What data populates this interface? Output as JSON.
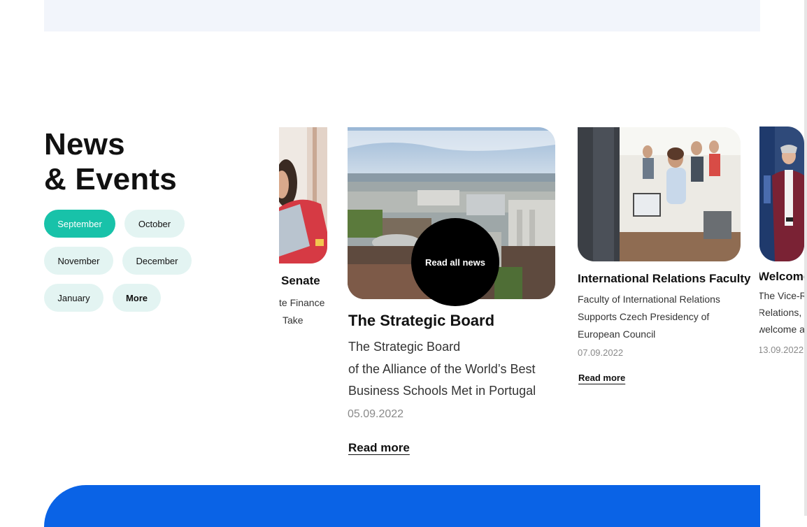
{
  "section": {
    "title_line1": "News",
    "title_line2": "& Events"
  },
  "months": [
    {
      "label": "September",
      "active": true
    },
    {
      "label": "October",
      "active": false
    },
    {
      "label": "November",
      "active": false
    },
    {
      "label": "December",
      "active": false
    },
    {
      "label": "January",
      "active": false
    },
    {
      "label": "More",
      "active": false
    }
  ],
  "cards": {
    "left": {
      "title": "Senate",
      "line1": "te Finance",
      "line2": "Take"
    },
    "main": {
      "title": "The Strategic Board",
      "line1": "The Strategic Board",
      "line2": "of the Alliance of the World’s Best",
      "line3": "Business Schools Met in Portugal",
      "date": "05.09.2022",
      "read_more": "Read more",
      "overlay_button": "Read all news"
    },
    "third": {
      "title": "International Relations Faculty",
      "line1": "Faculty of International Relations",
      "line2": "Supports Czech Presidency of",
      "line3": "European Council",
      "date": "07.09.2022",
      "read_more": "Read more"
    },
    "right": {
      "title": "Welcome",
      "line1": "The Vice-Re",
      "line2": "Relations, p",
      "line3": "welcome a",
      "date": "13.09.2022"
    }
  },
  "colors": {
    "accent": "#18c2a9",
    "pill_bg": "#e3f4f2",
    "blue_band": "#0a63e6",
    "top_band": "#f2f5fb"
  }
}
